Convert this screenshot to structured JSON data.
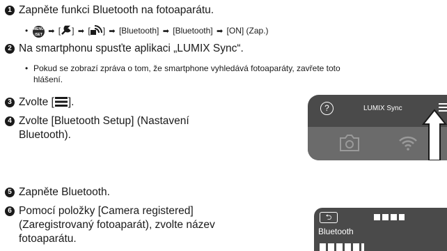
{
  "steps": [
    {
      "num": "1",
      "text": "Zapněte funkci Bluetooth na fotoaparátu."
    },
    {
      "num": "2",
      "text": "Na smartphonu spusťte aplikaci „LUMIX Sync“."
    },
    {
      "num": "3",
      "text": "Zvolte ["
    },
    {
      "num": "4",
      "text": "Zvolte [Bluetooth Setup] (Nastavení",
      "text2": "Bluetooth)."
    },
    {
      "num": "5",
      "text": "Zapněte Bluetooth."
    },
    {
      "num": "6",
      "text": "Pomocí položky [Camera registered]",
      "text2": "(Zaregistrovaný fotoaparát), zvolte název",
      "text3": "fotoaparátu."
    }
  ],
  "step1_sub": {
    "bullet": "•",
    "menu_icon_label": "MENU/SET",
    "parts": [
      "[",
      "]",
      "[",
      "]",
      "[Bluetooth]",
      "[Bluetooth]",
      "[ON] (Zap.)"
    ]
  },
  "step2_sub": {
    "bullet": "•",
    "line1": "Pokud se zobrazí zpráva o tom, že smartphone vyhledává fotoaparáty, zavřete toto",
    "line2": "hlášení."
  },
  "step3_close": "].",
  "phone1": {
    "title": "LUMIX Sync",
    "help": "?"
  },
  "phone2": {
    "section": "Bluetooth"
  }
}
